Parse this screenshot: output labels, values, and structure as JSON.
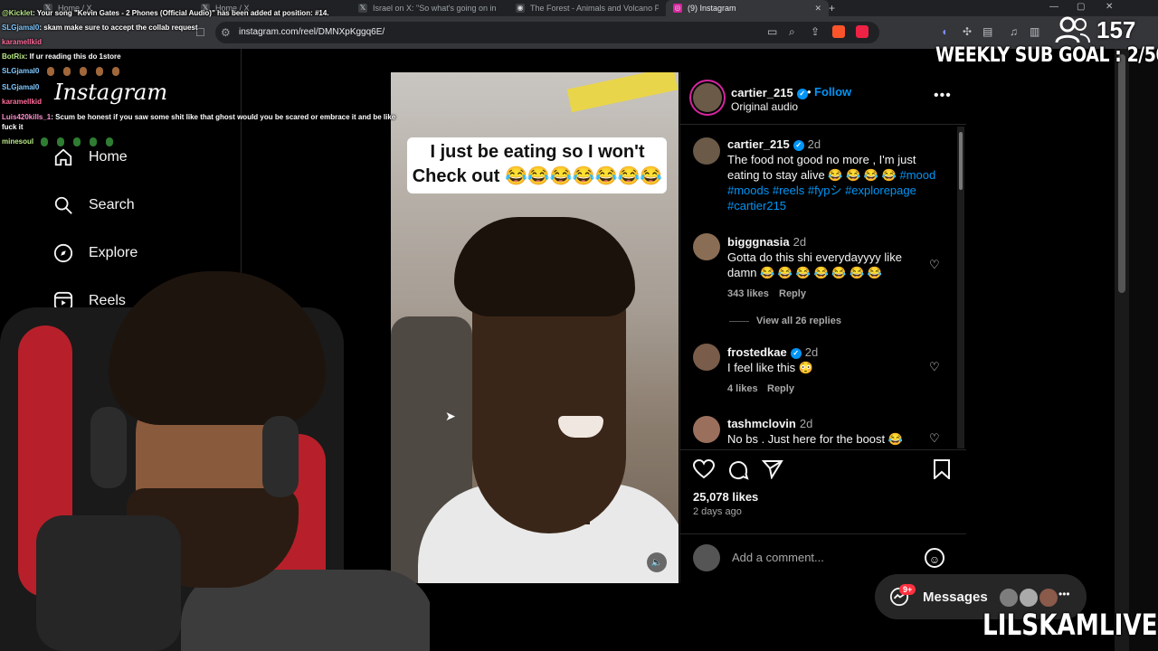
{
  "browser": {
    "tabs": [
      {
        "label": "Home / X",
        "icon": "x-logo-icon",
        "active": false
      },
      {
        "label": "Home / X",
        "icon": "x-logo-icon",
        "active": false
      },
      {
        "label": "Israel on X: \"So what's going on in",
        "icon": "x-logo-icon",
        "active": false
      },
      {
        "label": "The Forest - Animals and Volcano Pr",
        "icon": "globe-icon",
        "active": false
      },
      {
        "label": "(9) Instagram",
        "icon": "instagram-icon",
        "active": true
      }
    ],
    "url": "instagram.com/reel/DMNXpKggq6E/"
  },
  "chat": [
    {
      "user": "@Kicklet",
      "text": ": Your song \"Kevin Gates - 2 Phones (Official Audio)\" has been added at position: #14.",
      "color": "#b8e986"
    },
    {
      "user": "SLGjamal0",
      "text": ": skam make sure to accept the collab request",
      "color": "#7ec8ff"
    },
    {
      "user": "karamellkid",
      "text": "",
      "color": "#ff6b9a"
    },
    {
      "user": "BotRix",
      "text": ": If ur reading this do 1store",
      "color": "#b8e986"
    },
    {
      "user": "SLGjamal0",
      "text": "",
      "color": "#7ec8ff"
    },
    {
      "user": "SLGjamal0",
      "text": "",
      "color": "#7ec8ff"
    },
    {
      "user": "karamellkid",
      "text": "",
      "color": "#ff6b9a"
    },
    {
      "user": "Luis420kills_1",
      "text": ": Scum be honest if you saw some shit like that ghost would you be scared or embrace it and be like",
      "color": "#ff8fd0"
    },
    {
      "user": "",
      "text": "fuck it",
      "color": "#ffffff"
    },
    {
      "user": "minesoul",
      "text": "",
      "color": "#b8e986"
    }
  ],
  "instagram": {
    "logo": "Instagram",
    "nav": [
      {
        "label": "Home",
        "icon": "home-icon"
      },
      {
        "label": "Search",
        "icon": "search-icon"
      },
      {
        "label": "Explore",
        "icon": "compass-icon"
      },
      {
        "label": "Reels",
        "icon": "reels-icon"
      }
    ],
    "reel": {
      "caption_overlay": "I just be eating so I won't Check out 😂😂😂😂😂😂😂"
    },
    "post": {
      "author": "cartier_215",
      "follow_label": "Follow",
      "audio": "Original audio",
      "caption": {
        "user": "cartier_215",
        "time": "2d",
        "text": "The food not good no more , I'm just eating to stay alive 😂 😂 😂 😂",
        "hashtags": "#mood #moods #reels #fypシ #explorepage #cartier215"
      },
      "comments": [
        {
          "user": "bigggnasia",
          "verified": false,
          "time": "2d",
          "text": "Gotta do this shi everydayyyy like damn 😂 😂 😂 😂 😂 😂 😂",
          "likes": "343 likes",
          "reply": "Reply"
        },
        {
          "user": "frostedkae",
          "verified": true,
          "time": "2d",
          "text": "I feel like this 😳",
          "likes": "4 likes",
          "reply": "Reply"
        },
        {
          "user": "tashmclovin",
          "verified": false,
          "time": "2d",
          "text": "No bs . Just here for the boost 😂",
          "likes": "",
          "reply": ""
        }
      ],
      "view_replies": "View all 26 replies",
      "likes": "25,078 likes",
      "posted": "2 days ago",
      "add_comment_placeholder": "Add a comment..."
    },
    "messages": {
      "label": "Messages",
      "badge": "9+"
    }
  },
  "stream": {
    "subscriber_count": "157",
    "sub_goal": "WEEKLY SUB GOAL : 2/50",
    "channel": "LILSKAMLIVE"
  }
}
